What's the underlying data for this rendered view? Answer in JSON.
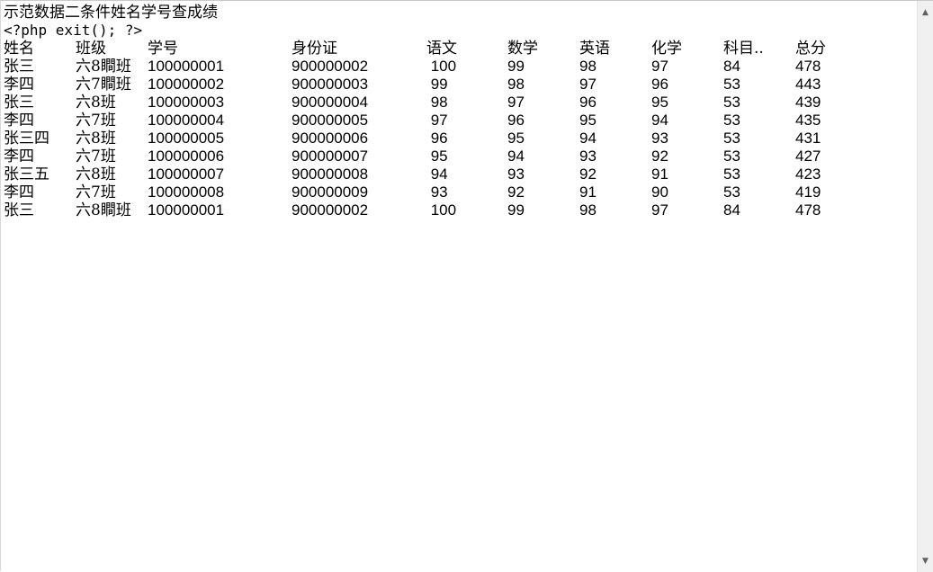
{
  "page": {
    "title": "示范数据二条件姓名学号查成绩",
    "code_line": "<?php exit(); ?>"
  },
  "table": {
    "headers": [
      "姓名",
      "班级",
      "学号",
      "身份证",
      "语文",
      "数学",
      "英语",
      "化学",
      "科目..",
      "总分"
    ],
    "rows": [
      [
        "张三",
        "六8瞷班",
        "100000001",
        "900000002",
        " 100",
        "99",
        "98",
        "97",
        "84",
        "478"
      ],
      [
        "李四",
        "六7瞷班",
        "100000002",
        "900000003",
        " 99",
        "98",
        "97",
        "96",
        "53",
        "443"
      ],
      [
        "张三",
        "六8班",
        "100000003",
        "900000004",
        " 98",
        "97",
        "96",
        "95",
        "53",
        "439"
      ],
      [
        "李四",
        "六7班",
        "100000004",
        "900000005",
        " 97",
        "96",
        "95",
        "94",
        "53",
        "435"
      ],
      [
        "张三四",
        "六8班",
        "100000005",
        "900000006",
        " 96",
        "95",
        "94",
        "93",
        "53",
        "431"
      ],
      [
        "李四",
        "六7班",
        "100000006",
        "900000007",
        " 95",
        "94",
        "93",
        "92",
        "53",
        "427"
      ],
      [
        "张三五",
        "六8班",
        "100000007",
        "900000008",
        " 94",
        "93",
        "92",
        "91",
        "53",
        "423"
      ],
      [
        "李四",
        "六7班",
        "100000008",
        "900000009",
        " 93",
        "92",
        "91",
        "90",
        "53",
        "419"
      ],
      [
        "张三",
        "六8瞷班",
        "100000001",
        "900000002",
        " 100",
        "99",
        "98",
        "97",
        "84",
        "478"
      ]
    ]
  },
  "scrollbar": {
    "up_icon": "scroll-up-arrow-icon",
    "down_icon": "scroll-down-arrow-icon"
  }
}
